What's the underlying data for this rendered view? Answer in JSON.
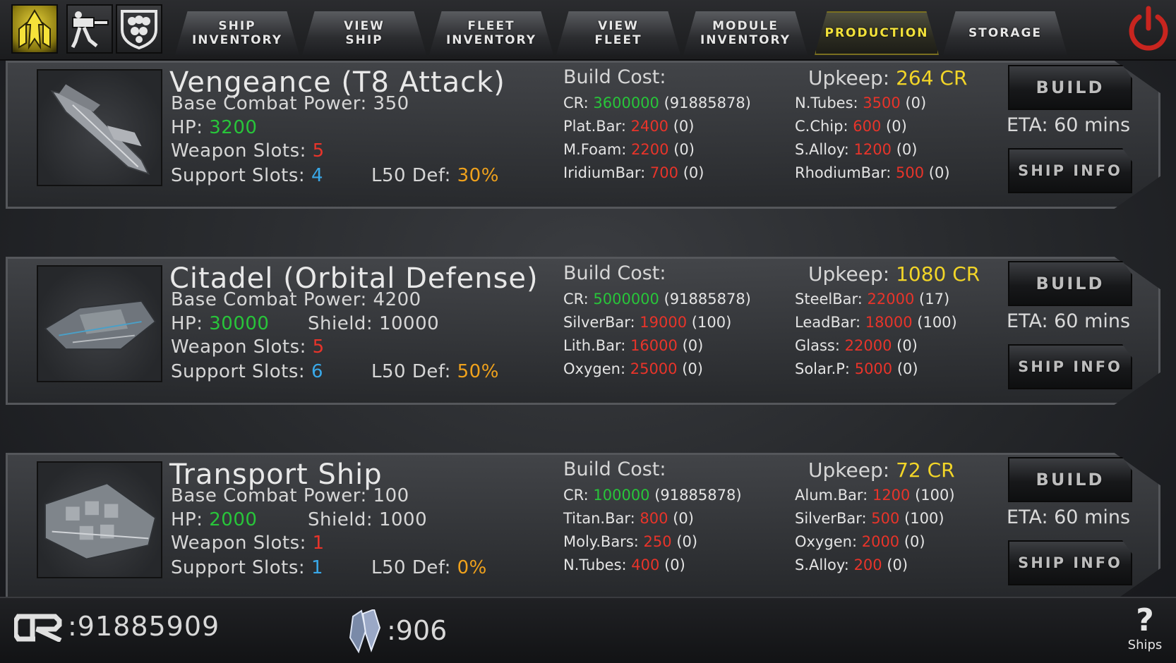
{
  "top_bar": {
    "icons": [
      "command-icon",
      "turret-icon",
      "fleet-shield-icon",
      "power-icon"
    ],
    "tabs": [
      {
        "label": "SHIP\nINVENTORY",
        "active": false
      },
      {
        "label": "VIEW\nSHIP",
        "active": false
      },
      {
        "label": "FLEET\nINVENTORY",
        "active": false
      },
      {
        "label": "VIEW\nFLEET",
        "active": false
      },
      {
        "label": "MODULE\nINVENTORY",
        "active": false
      },
      {
        "label": "PRODUCTION",
        "active": true
      },
      {
        "label": "STORAGE",
        "active": false
      }
    ]
  },
  "ships": [
    {
      "name": "Vengeance (T8 Attack)",
      "base_combat_power_label": "Base Combat Power:",
      "base_combat_power": "350",
      "hp_label": "HP:",
      "hp": "3200",
      "shield_label": "",
      "shield": "",
      "weapon_slots_label": "Weapon Slots:",
      "weapon_slots": "5",
      "support_slots_label": "Support Slots:",
      "support_slots": "4",
      "l50_def_label": "L50 Def:",
      "l50_def": "30%",
      "build_cost_label": "Build Cost:",
      "upkeep_label": "Upkeep:",
      "upkeep": "264 CR",
      "resources_left": [
        {
          "name": "CR:",
          "amount": "3600000",
          "owned": "(91885878)",
          "color": "green"
        },
        {
          "name": "Plat.Bar:",
          "amount": "2400",
          "owned": "(0)",
          "color": "red"
        },
        {
          "name": "M.Foam:",
          "amount": "2200",
          "owned": "(0)",
          "color": "red"
        },
        {
          "name": "IridiumBar:",
          "amount": "700",
          "owned": "(0)",
          "color": "red"
        }
      ],
      "resources_right": [
        {
          "name": "N.Tubes:",
          "amount": "3500",
          "owned": "(0)",
          "color": "red"
        },
        {
          "name": "C.Chip:",
          "amount": "600",
          "owned": "(0)",
          "color": "red"
        },
        {
          "name": "S.Alloy:",
          "amount": "1200",
          "owned": "(0)",
          "color": "red"
        },
        {
          "name": "RhodiumBar:",
          "amount": "500",
          "owned": "(0)",
          "color": "red"
        }
      ],
      "build_label": "BUILD",
      "eta": "ETA: 60 mins",
      "info_label": "SHIP INFO"
    },
    {
      "name": "Citadel (Orbital Defense)",
      "base_combat_power_label": "Base Combat Power:",
      "base_combat_power": "4200",
      "hp_label": "HP:",
      "hp": "30000",
      "shield_label": "Shield:",
      "shield": "10000",
      "weapon_slots_label": "Weapon Slots:",
      "weapon_slots": "5",
      "support_slots_label": "Support Slots:",
      "support_slots": "6",
      "l50_def_label": "L50 Def:",
      "l50_def": "50%",
      "build_cost_label": "Build Cost:",
      "upkeep_label": "Upkeep:",
      "upkeep": "1080 CR",
      "resources_left": [
        {
          "name": "CR:",
          "amount": "5000000",
          "owned": "(91885878)",
          "color": "green"
        },
        {
          "name": "SilverBar:",
          "amount": "19000",
          "owned": "(100)",
          "color": "red"
        },
        {
          "name": "Lith.Bar:",
          "amount": "16000",
          "owned": "(0)",
          "color": "red"
        },
        {
          "name": "Oxygen:",
          "amount": "25000",
          "owned": "(0)",
          "color": "red"
        }
      ],
      "resources_right": [
        {
          "name": "SteelBar:",
          "amount": "22000",
          "owned": "(17)",
          "color": "red"
        },
        {
          "name": "LeadBar:",
          "amount": "18000",
          "owned": "(100)",
          "color": "red"
        },
        {
          "name": "Glass:",
          "amount": "22000",
          "owned": "(0)",
          "color": "red"
        },
        {
          "name": "Solar.P:",
          "amount": "5000",
          "owned": "(0)",
          "color": "red"
        }
      ],
      "build_label": "BUILD",
      "eta": "ETA: 60 mins",
      "info_label": "SHIP INFO"
    },
    {
      "name": "Transport Ship",
      "base_combat_power_label": "Base Combat Power:",
      "base_combat_power": "100",
      "hp_label": "HP:",
      "hp": "2000",
      "shield_label": "Shield:",
      "shield": "1000",
      "weapon_slots_label": "Weapon Slots:",
      "weapon_slots": "1",
      "support_slots_label": "Support Slots:",
      "support_slots": "1",
      "l50_def_label": "L50 Def:",
      "l50_def": "0%",
      "build_cost_label": "Build Cost:",
      "upkeep_label": "Upkeep:",
      "upkeep": "72 CR",
      "resources_left": [
        {
          "name": "CR:",
          "amount": "100000",
          "owned": "(91885878)",
          "color": "green"
        },
        {
          "name": "Titan.Bar:",
          "amount": "800",
          "owned": "(0)",
          "color": "red"
        },
        {
          "name": "Moly.Bars:",
          "amount": "250",
          "owned": "(0)",
          "color": "red"
        },
        {
          "name": "N.Tubes:",
          "amount": "400",
          "owned": "(0)",
          "color": "red"
        }
      ],
      "resources_right": [
        {
          "name": "Alum.Bar:",
          "amount": "1200",
          "owned": "(100)",
          "color": "red"
        },
        {
          "name": "SilverBar:",
          "amount": "500",
          "owned": "(100)",
          "color": "red"
        },
        {
          "name": "Oxygen:",
          "amount": "2000",
          "owned": "(0)",
          "color": "red"
        },
        {
          "name": "S.Alloy:",
          "amount": "200",
          "owned": "(0)",
          "color": "red"
        }
      ],
      "build_label": "BUILD",
      "eta": "ETA: 60 mins",
      "info_label": "SHIP INFO"
    }
  ],
  "bottom_bar": {
    "credits_icon": "cr-logo-icon",
    "credits": ":91885909",
    "crystals_icon": "crystal-icon",
    "crystals": ":906",
    "help_icon": "question-icon",
    "help_symbol": "?",
    "help_label": "Ships"
  },
  "colors": {
    "green": "#28c53a",
    "red": "#e8342a",
    "blue": "#39a8e8",
    "orange": "#f0a21c",
    "yellow": "#f2d528"
  }
}
